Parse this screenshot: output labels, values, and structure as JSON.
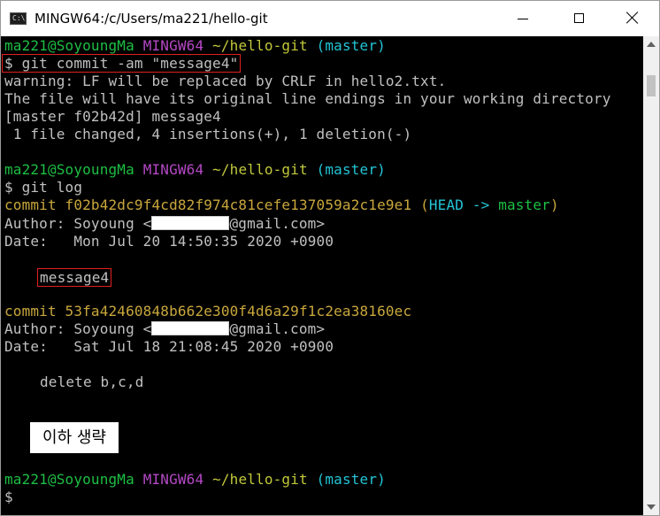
{
  "window": {
    "title": "MINGW64:/c/Users/ma221/hello-git",
    "icon_name": "terminal-icon",
    "icon_text": "C:\\"
  },
  "terminal": {
    "prompt1": {
      "user": "ma221@SoyoungMa",
      "shell": "MINGW64",
      "path": "~/hello-git",
      "branch": "(master)"
    },
    "cmd1": "$ git commit -am \"message4\"",
    "out1": "warning: LF will be replaced by CRLF in hello2.txt.",
    "out2": "The file will have its original line endings in your working directory",
    "out3": "[master f02b42d] message4",
    "out4": " 1 file changed, 4 insertions(+), 1 deletion(-)",
    "prompt2": {
      "user": "ma221@SoyoungMa",
      "shell": "MINGW64",
      "path": "~/hello-git",
      "branch": "(master)"
    },
    "cmd2": "$ git log",
    "commit1": {
      "label": "commit f02b42dc9f4cd82f974c81cefe137059a2c1e9e1",
      "ref_open": "(",
      "ref_head": "HEAD -> ",
      "ref_branch": "master",
      "ref_close": ")",
      "author_prefix": "Author: Soyoung <",
      "author_suffix": "@gmail.com>",
      "date": "Date:   Mon Jul 20 14:50:35 2020 +0900",
      "message": "message4"
    },
    "commit2": {
      "label": "commit 53fa42460848b662e300f4d6a29f1c2ea38160ec",
      "author_prefix": "Author: Soyoung <",
      "author_suffix": "@gmail.com>",
      "date": "Date:   Sat Jul 18 21:08:45 2020 +0900",
      "message": "delete b,c,d"
    },
    "caption": "이하 생략",
    "prompt3": {
      "user": "ma221@SoyoungMa",
      "shell": "MINGW64",
      "path": "~/hello-git",
      "branch": "(master)"
    },
    "cmd3": "$"
  }
}
